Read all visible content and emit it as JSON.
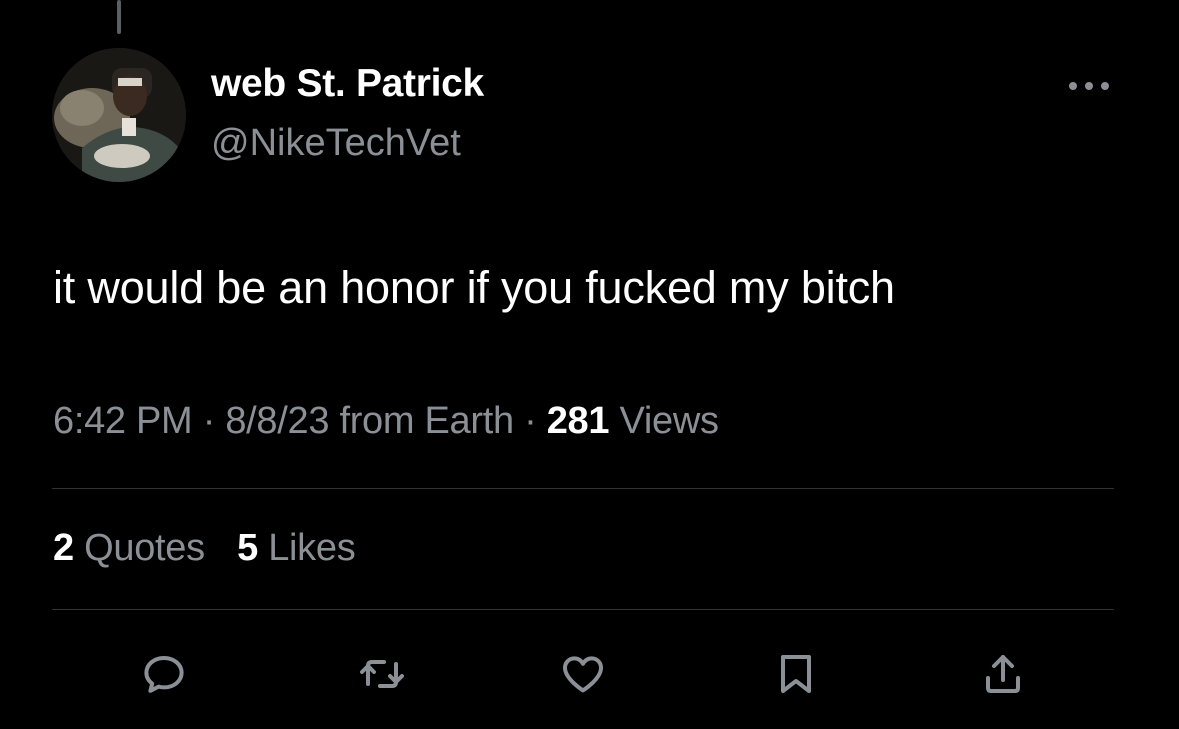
{
  "tweet": {
    "display_name": "web St. Patrick",
    "handle": "@NikeTechVet",
    "text": "it would be an honor if you fucked my bitch",
    "time": "6:42 PM",
    "date": "8/8/23",
    "source": "from Earth",
    "views_count": "281",
    "views_label": "Views",
    "separator": "·"
  },
  "stats": {
    "quotes_count": "2",
    "quotes_label": "Quotes",
    "likes_count": "5",
    "likes_label": "Likes"
  },
  "icons": {
    "more": "more-dots-icon",
    "reply": "reply-icon",
    "retweet": "retweet-icon",
    "like": "heart-icon",
    "bookmark": "bookmark-icon",
    "share": "share-icon"
  },
  "colors": {
    "background": "#000000",
    "primary_text": "#ffffff",
    "secondary_text": "#8b9096",
    "divider": "#2f3336"
  }
}
